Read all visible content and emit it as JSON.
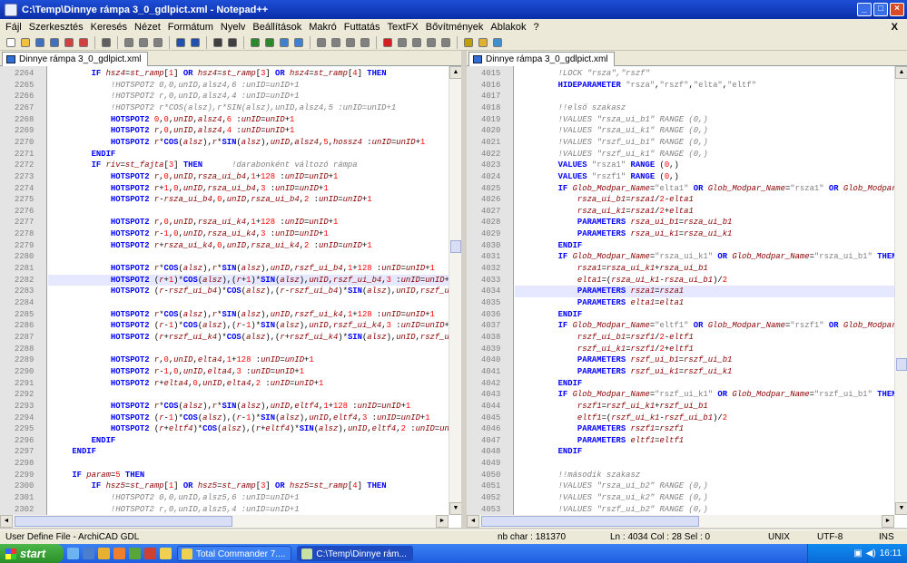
{
  "window": {
    "title": "C:\\Temp\\Dinnye rámpa 3_0_gdlpict.xml - Notepad++"
  },
  "menu": [
    "Fájl",
    "Szerkesztés",
    "Keresés",
    "Nézet",
    "Formátum",
    "Nyelv",
    "Beállítások",
    "Makró",
    "Futtatás",
    "TextFX",
    "Bővítmények",
    "Ablakok",
    "?"
  ],
  "menu_close": "X",
  "toolbar_icons": [
    "new-file-icon",
    "open-file-icon",
    "save-icon",
    "save-all-icon",
    "close-icon",
    "close-all-icon",
    "print-icon",
    "cut-icon",
    "copy-icon",
    "paste-icon",
    "undo-icon",
    "redo-icon",
    "find-icon",
    "replace-icon",
    "zoom-in-icon",
    "zoom-out-icon",
    "sync-v-icon",
    "sync-h-icon",
    "wrap-icon",
    "all-chars-icon",
    "indent-guide-icon",
    "doc-map-icon",
    "record-icon",
    "stop-icon",
    "play-icon",
    "play-multi-icon",
    "save-macro-icon",
    "launch-icon",
    "open-folder-icon",
    "check-icon"
  ],
  "left": {
    "tab": "Dinnye rámpa 3_0_gdlpict.xml",
    "lines": [
      {
        "n": "2264",
        "html": "        <span class='kw'>IF</span> <span class='var'>hsz4</span>=<span class='var'>st_ramp</span>[<span class='num'>1</span>] <span class='kw'>OR</span> <span class='var'>hsz4</span>=<span class='var'>st_ramp</span>[<span class='num'>3</span>] <span class='kw'>OR</span> <span class='var'>hsz4</span>=<span class='var'>st_ramp</span>[<span class='num'>4</span>] <span class='kw'>THEN</span>"
      },
      {
        "n": "2265",
        "html": "            <span class='cm'>!HOTSPOT2 0,0,unID,alsz4,6 :unID=unID+1</span>"
      },
      {
        "n": "2266",
        "html": "            <span class='cm'>!HOTSPOT2 r,0,unID,alsz4,4 :unID=unID+1</span>"
      },
      {
        "n": "2267",
        "html": "            <span class='cm'>!HOTSPOT2 r*COS(alsz),r*SIN(alsz),unID,alsz4,5 :unID=unID+1</span>"
      },
      {
        "n": "2268",
        "html": "            <span class='kw'>HOTSPOT2</span> <span class='num'>0</span>,<span class='num'>0</span>,<span class='var'>unID</span>,<span class='var'>alsz4</span>,<span class='num'>6</span> :<span class='var'>unID</span>=<span class='var'>unID</span>+<span class='num'>1</span>"
      },
      {
        "n": "2269",
        "html": "            <span class='kw'>HOTSPOT2</span> <span class='var'>r</span>,<span class='num'>0</span>,<span class='var'>unID</span>,<span class='var'>alsz4</span>,<span class='num'>4</span> :<span class='var'>unID</span>=<span class='var'>unID</span>+<span class='num'>1</span>"
      },
      {
        "n": "2270",
        "html": "            <span class='kw'>HOTSPOT2</span> <span class='var'>r</span>*<span class='kw'>COS</span>(<span class='var'>alsz</span>),<span class='var'>r</span>*<span class='kw'>SIN</span>(<span class='var'>alsz</span>),<span class='var'>unID</span>,<span class='var'>alsz4</span>,<span class='num'>5</span>,<span class='var'>hossz4</span> :<span class='var'>unID</span>=<span class='var'>unID</span>+<span class='num'>1</span>"
      },
      {
        "n": "2271",
        "html": "        <span class='kw'>ENDIF</span>"
      },
      {
        "n": "2272",
        "html": "        <span class='kw'>IF</span> <span class='var'>riv</span>=<span class='var'>st_fajta</span>[<span class='num'>3</span>] <span class='kw'>THEN</span>      <span class='cm'>!darabonként változó rámpa</span>"
      },
      {
        "n": "2273",
        "html": "            <span class='kw'>HOTSPOT2</span> <span class='var'>r</span>,<span class='num'>0</span>,<span class='var'>unID</span>,<span class='var'>rsza_ui_b4</span>,<span class='num'>1</span>+<span class='num'>128</span> :<span class='var'>unID</span>=<span class='var'>unID</span>+<span class='num'>1</span>"
      },
      {
        "n": "2274",
        "html": "            <span class='kw'>HOTSPOT2</span> <span class='var'>r</span>+<span class='num'>1</span>,<span class='num'>0</span>,<span class='var'>unID</span>,<span class='var'>rsza_ui_b4</span>,<span class='num'>3</span> :<span class='var'>unID</span>=<span class='var'>unID</span>+<span class='num'>1</span>"
      },
      {
        "n": "2275",
        "html": "            <span class='kw'>HOTSPOT2</span> <span class='var'>r</span>-<span class='var'>rsza_ui_b4</span>,<span class='num'>0</span>,<span class='var'>unID</span>,<span class='var'>rsza_ui_b4</span>,<span class='num'>2</span> :<span class='var'>unID</span>=<span class='var'>unID</span>+<span class='num'>1</span>"
      },
      {
        "n": "2276",
        "html": ""
      },
      {
        "n": "2277",
        "html": "            <span class='kw'>HOTSPOT2</span> <span class='var'>r</span>,<span class='num'>0</span>,<span class='var'>unID</span>,<span class='var'>rsza_ui_k4</span>,<span class='num'>1</span>+<span class='num'>128</span> :<span class='var'>unID</span>=<span class='var'>unID</span>+<span class='num'>1</span>"
      },
      {
        "n": "2278",
        "html": "            <span class='kw'>HOTSPOT2</span> <span class='var'>r</span>-<span class='num'>1</span>,<span class='num'>0</span>,<span class='var'>unID</span>,<span class='var'>rsza_ui_k4</span>,<span class='num'>3</span> :<span class='var'>unID</span>=<span class='var'>unID</span>+<span class='num'>1</span>"
      },
      {
        "n": "2279",
        "html": "            <span class='kw'>HOTSPOT2</span> <span class='var'>r</span>+<span class='var'>rsza_ui_k4</span>,<span class='num'>0</span>,<span class='var'>unID</span>,<span class='var'>rsza_ui_k4</span>,<span class='num'>2</span> :<span class='var'>unID</span>=<span class='var'>unID</span>+<span class='num'>1</span>"
      },
      {
        "n": "2280",
        "html": ""
      },
      {
        "n": "2281",
        "html": "            <span class='kw'>HOTSPOT2</span> <span class='var'>r</span>*<span class='kw'>COS</span>(<span class='var'>alsz</span>),<span class='var'>r</span>*<span class='kw'>SIN</span>(<span class='var'>alsz</span>),<span class='var'>unID</span>,<span class='var'>rszf_ui_b4</span>,<span class='num'>1</span>+<span class='num'>128</span> :<span class='var'>unID</span>=<span class='var'>unID</span>+<span class='num'>1</span>"
      },
      {
        "n": "2282",
        "html": "            <span class='kw'>HOTSPOT2</span> (<span class='var'>r</span>+<span class='num'>1</span>)*<span class='kw'>COS</span>(<span class='var'>alsz</span>),(<span class='var'>r</span>+<span class='num'>1</span>)*<span class='kw'>SIN</span>(<span class='var'>alsz</span>),<span class='var'>unID</span>,<span class='var'>rszf_ui_b4</span>,<span class='num'>3</span> :<span class='var'>unID</span>=<span class='var'>unID</span>+"
      },
      {
        "n": "2283",
        "html": "            <span class='kw'>HOTSPOT2</span> (<span class='var'>r</span>-<span class='var'>rszf_ui_b4</span>)*<span class='kw'>COS</span>(<span class='var'>alsz</span>),(<span class='var'>r</span>-<span class='var'>rszf_ui_b4</span>)*<span class='kw'>SIN</span>(<span class='var'>alsz</span>),<span class='var'>unID</span>,<span class='var'>rszf_u</span>"
      },
      {
        "n": "2284",
        "html": ""
      },
      {
        "n": "2285",
        "html": "            <span class='kw'>HOTSPOT2</span> <span class='var'>r</span>*<span class='kw'>COS</span>(<span class='var'>alsz</span>),<span class='var'>r</span>*<span class='kw'>SIN</span>(<span class='var'>alsz</span>),<span class='var'>unID</span>,<span class='var'>rszf_ui_k4</span>,<span class='num'>1</span>+<span class='num'>128</span> :<span class='var'>unID</span>=<span class='var'>unID</span>+<span class='num'>1</span>"
      },
      {
        "n": "2286",
        "html": "            <span class='kw'>HOTSPOT2</span> (<span class='var'>r</span>-<span class='num'>1</span>)*<span class='kw'>COS</span>(<span class='var'>alsz</span>),(<span class='var'>r</span>-<span class='num'>1</span>)*<span class='kw'>SIN</span>(<span class='var'>alsz</span>),<span class='var'>unID</span>,<span class='var'>rszf_ui_k4</span>,<span class='num'>3</span> :<span class='var'>unID</span>=<span class='var'>unID</span>+"
      },
      {
        "n": "2287",
        "html": "            <span class='kw'>HOTSPOT2</span> (<span class='var'>r</span>+<span class='var'>rszf_ui_k4</span>)*<span class='kw'>COS</span>(<span class='var'>alsz</span>),(<span class='var'>r</span>+<span class='var'>rszf_ui_k4</span>)*<span class='kw'>SIN</span>(<span class='var'>alsz</span>),<span class='var'>unID</span>,<span class='var'>rszf_u</span>"
      },
      {
        "n": "2288",
        "html": ""
      },
      {
        "n": "2289",
        "html": "            <span class='kw'>HOTSPOT2</span> <span class='var'>r</span>,<span class='num'>0</span>,<span class='var'>unID</span>,<span class='var'>elta4</span>,<span class='num'>1</span>+<span class='num'>128</span> :<span class='var'>unID</span>=<span class='var'>unID</span>+<span class='num'>1</span>"
      },
      {
        "n": "2290",
        "html": "            <span class='kw'>HOTSPOT2</span> <span class='var'>r</span>-<span class='num'>1</span>,<span class='num'>0</span>,<span class='var'>unID</span>,<span class='var'>elta4</span>,<span class='num'>3</span> :<span class='var'>unID</span>=<span class='var'>unID</span>+<span class='num'>1</span>"
      },
      {
        "n": "2291",
        "html": "            <span class='kw'>HOTSPOT2</span> <span class='var'>r</span>+<span class='var'>elta4</span>,<span class='num'>0</span>,<span class='var'>unID</span>,<span class='var'>elta4</span>,<span class='num'>2</span> :<span class='var'>unID</span>=<span class='var'>unID</span>+<span class='num'>1</span>"
      },
      {
        "n": "2292",
        "html": ""
      },
      {
        "n": "2293",
        "html": "            <span class='kw'>HOTSPOT2</span> <span class='var'>r</span>*<span class='kw'>COS</span>(<span class='var'>alsz</span>),<span class='var'>r</span>*<span class='kw'>SIN</span>(<span class='var'>alsz</span>),<span class='var'>unID</span>,<span class='var'>eltf4</span>,<span class='num'>1</span>+<span class='num'>128</span> :<span class='var'>unID</span>=<span class='var'>unID</span>+<span class='num'>1</span>"
      },
      {
        "n": "2294",
        "html": "            <span class='kw'>HOTSPOT2</span> (<span class='var'>r</span>-<span class='num'>1</span>)*<span class='kw'>COS</span>(<span class='var'>alsz</span>),(<span class='var'>r</span>-<span class='num'>1</span>)*<span class='kw'>SIN</span>(<span class='var'>alsz</span>),<span class='var'>unID</span>,<span class='var'>eltf4</span>,<span class='num'>3</span> :<span class='var'>unID</span>=<span class='var'>unID</span>+<span class='num'>1</span>"
      },
      {
        "n": "2295",
        "html": "            <span class='kw'>HOTSPOT2</span> (<span class='var'>r</span>+<span class='var'>eltf4</span>)*<span class='kw'>COS</span>(<span class='var'>alsz</span>),(<span class='var'>r</span>+<span class='var'>eltf4</span>)*<span class='kw'>SIN</span>(<span class='var'>alsz</span>),<span class='var'>unID</span>,<span class='var'>eltf4</span>,<span class='num'>2</span> :<span class='var'>unID</span>=<span class='var'>un</span>"
      },
      {
        "n": "2296",
        "html": "        <span class='kw'>ENDIF</span>"
      },
      {
        "n": "2297",
        "html": "    <span class='kw'>ENDIF</span>"
      },
      {
        "n": "2298",
        "html": ""
      },
      {
        "n": "2299",
        "html": "    <span class='kw'>IF</span> <span class='var'>param</span>=<span class='num'>5</span> <span class='kw'>THEN</span>"
      },
      {
        "n": "2300",
        "html": "        <span class='kw'>IF</span> <span class='var'>hsz5</span>=<span class='var'>st_ramp</span>[<span class='num'>1</span>] <span class='kw'>OR</span> <span class='var'>hsz5</span>=<span class='var'>st_ramp</span>[<span class='num'>3</span>] <span class='kw'>OR</span> <span class='var'>hsz5</span>=<span class='var'>st_ramp</span>[<span class='num'>4</span>] <span class='kw'>THEN</span>"
      },
      {
        "n": "2301",
        "html": "            <span class='cm'>!HOTSPOT2 0,0,unID,alsz5,6 :unID=unID+1</span>"
      },
      {
        "n": "2302",
        "html": "            <span class='cm'>!HOTSPOT2 r,0,unID,alsz5,4 :unID=unID+1</span>"
      },
      {
        "n": "2303",
        "html": "            <span class='cm'>!HOTSPOT2 r*COS(alsz),r*SIN(alsz),unID,alsz5,5 :unID=unID+1</span>"
      }
    ],
    "highlight": "2282"
  },
  "right": {
    "tab": "Dinnye rámpa 3_0_gdlpict.xml",
    "lines": [
      {
        "n": "4015",
        "html": "        <span class='cm'>!LOCK \"rsza\",\"rszf\"</span>"
      },
      {
        "n": "4016",
        "html": "        <span class='kw'>HIDEPARAMETER</span> <span class='str'>\"rsza\"</span>,<span class='str'>\"rszf\"</span>,<span class='str'>\"elta\"</span>,<span class='str'>\"eltf\"</span>"
      },
      {
        "n": "4017",
        "html": ""
      },
      {
        "n": "4018",
        "html": "        <span class='cm'>!!első szakasz</span>"
      },
      {
        "n": "4019",
        "html": "        <span class='cm'>!VALUES \"rsza_ui_b1\" RANGE (0,)</span>"
      },
      {
        "n": "4020",
        "html": "        <span class='cm'>!VALUES \"rsza_ui_k1\" RANGE (0,)</span>"
      },
      {
        "n": "4021",
        "html": "        <span class='cm'>!VALUES \"rszf_ui_b1\" RANGE (0,)</span>"
      },
      {
        "n": "4022",
        "html": "        <span class='cm'>!VALUES \"rszf_ui_k1\" RANGE (0,)</span>"
      },
      {
        "n": "4023",
        "html": "        <span class='kw'>VALUES</span> <span class='str'>\"rsza1\"</span> <span class='kw'>RANGE</span> (<span class='num'>0</span>,)"
      },
      {
        "n": "4024",
        "html": "        <span class='kw'>VALUES</span> <span class='str'>\"rszf1\"</span> <span class='kw'>RANGE</span> (<span class='num'>0</span>,)"
      },
      {
        "n": "4025",
        "html": "        <span class='kw'>IF</span> <span class='var'>Glob_Modpar_Name</span>=<span class='str'>\"elta1\"</span> <span class='kw'>OR</span> <span class='var'>Glob_Modpar_Name</span>=<span class='str'>\"rsza1\"</span> <span class='kw'>OR</span> <span class='var'>Glob_Modpar</span>"
      },
      {
        "n": "4026",
        "html": "            <span class='var'>rsza_ui_b1</span>=<span class='var'>rsza1</span>/<span class='num'>2</span>-<span class='var'>elta1</span>"
      },
      {
        "n": "4027",
        "html": "            <span class='var'>rsza_ui_k1</span>=<span class='var'>rsza1</span>/<span class='num'>2</span>+<span class='var'>elta1</span>"
      },
      {
        "n": "4028",
        "html": "            <span class='kw'>PARAMETERS</span> <span class='var'>rsza_ui_b1</span>=<span class='var'>rsza_ui_b1</span>"
      },
      {
        "n": "4029",
        "html": "            <span class='kw'>PARAMETERS</span> <span class='var'>rsza_ui_k1</span>=<span class='var'>rsza_ui_k1</span>"
      },
      {
        "n": "4030",
        "html": "        <span class='kw'>ENDIF</span>"
      },
      {
        "n": "4031",
        "html": "        <span class='kw'>IF</span> <span class='var'>Glob_Modpar_Name</span>=<span class='str'>\"rsza_ui_k1\"</span> <span class='kw'>OR</span> <span class='var'>Glob_Modpar_Name</span>=<span class='str'>\"rsza_ui_b1\"</span> <span class='kw'>THEN</span>"
      },
      {
        "n": "4032",
        "html": "            <span class='var'>rsza1</span>=<span class='var'>rsza_ui_k1</span>+<span class='var'>rsza_ui_b1</span>"
      },
      {
        "n": "4033",
        "html": "            <span class='var'>elta1</span>=(<span class='var'>rsza_ui_k1</span>-<span class='var'>rsza_ui_b1</span>)/<span class='num'>2</span>"
      },
      {
        "n": "4034",
        "html": "            <span class='kw'>PARAMETERS</span> <span class='var'>rsza1</span>=<span class='var'>rsza1</span>"
      },
      {
        "n": "4035",
        "html": "            <span class='kw'>PARAMETERS</span> <span class='var'>elta1</span>=<span class='var'>elta1</span>"
      },
      {
        "n": "4036",
        "html": "        <span class='kw'>ENDIF</span>"
      },
      {
        "n": "4037",
        "html": "        <span class='kw'>IF</span> <span class='var'>Glob_Modpar_Name</span>=<span class='str'>\"eltf1\"</span> <span class='kw'>OR</span> <span class='var'>Glob_Modpar_Name</span>=<span class='str'>\"rszf1\"</span> <span class='kw'>OR</span> <span class='var'>Glob_Modpar</span>"
      },
      {
        "n": "4038",
        "html": "            <span class='var'>rszf_ui_b1</span>=<span class='var'>rszf1</span>/<span class='num'>2</span>-<span class='var'>eltf1</span>"
      },
      {
        "n": "4039",
        "html": "            <span class='var'>rszf_ui_k1</span>=<span class='var'>rszf1</span>/<span class='num'>2</span>+<span class='var'>eltf1</span>"
      },
      {
        "n": "4040",
        "html": "            <span class='kw'>PARAMETERS</span> <span class='var'>rszf_ui_b1</span>=<span class='var'>rszf_ui_b1</span>"
      },
      {
        "n": "4041",
        "html": "            <span class='kw'>PARAMETERS</span> <span class='var'>rszf_ui_k1</span>=<span class='var'>rszf_ui_k1</span>"
      },
      {
        "n": "4042",
        "html": "        <span class='kw'>ENDIF</span>"
      },
      {
        "n": "4043",
        "html": "        <span class='kw'>IF</span> <span class='var'>Glob_Modpar_Name</span>=<span class='str'>\"rszf_ui_k1\"</span> <span class='kw'>OR</span> <span class='var'>Glob_Modpar_Name</span>=<span class='str'>\"rszf_ui_b1\"</span> <span class='kw'>THEN</span>"
      },
      {
        "n": "4044",
        "html": "            <span class='var'>rszf1</span>=<span class='var'>rszf_ui_k1</span>+<span class='var'>rszf_ui_b1</span>"
      },
      {
        "n": "4045",
        "html": "            <span class='var'>eltf1</span>=(<span class='var'>rszf_ui_k1</span>-<span class='var'>rszf_ui_b1</span>)/<span class='num'>2</span>"
      },
      {
        "n": "4046",
        "html": "            <span class='kw'>PARAMETERS</span> <span class='var'>rszf1</span>=<span class='var'>rszf1</span>"
      },
      {
        "n": "4047",
        "html": "            <span class='kw'>PARAMETERS</span> <span class='var'>eltf1</span>=<span class='var'>eltf1</span>"
      },
      {
        "n": "4048",
        "html": "        <span class='kw'>ENDIF</span>"
      },
      {
        "n": "4049",
        "html": ""
      },
      {
        "n": "4050",
        "html": "        <span class='cm'>!!második szakasz</span>"
      },
      {
        "n": "4051",
        "html": "        <span class='cm'>!VALUES \"rsza_ui_b2\" RANGE (0,)</span>"
      },
      {
        "n": "4052",
        "html": "        <span class='cm'>!VALUES \"rsza_ui_k2\" RANGE (0,)</span>"
      },
      {
        "n": "4053",
        "html": "        <span class='cm'>!VALUES \"rszf_ui_b2\" RANGE (0,)</span>"
      },
      {
        "n": "4054",
        "html": "        <span class='cm'>!VALUES \"rszf_ui_k2\" RANGE (0,)</span>"
      }
    ],
    "highlight": "4034"
  },
  "status": {
    "language": "User Define File - ArchiCAD GDL",
    "nb_char": "nb char : 181370",
    "position": "Ln : 4034   Col : 28   Sel : 0",
    "eol": "UNIX",
    "encoding": "UTF-8",
    "mode": "INS"
  },
  "taskbar": {
    "start": "start",
    "tasks": [
      "Total Commander 7....",
      "C:\\Temp\\Dinnye rám..."
    ],
    "clock": "16:11"
  }
}
